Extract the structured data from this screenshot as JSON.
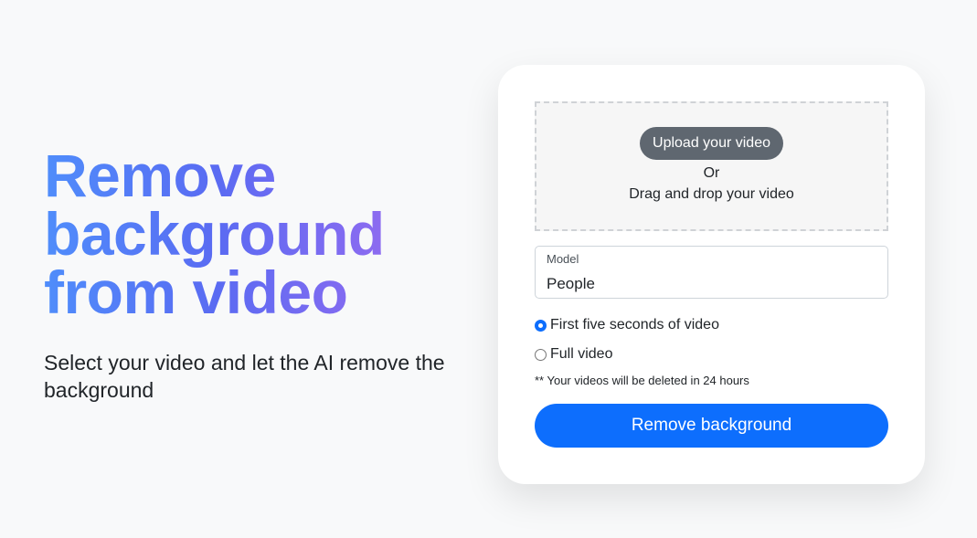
{
  "hero": {
    "title": "Remove background from video",
    "subtitle": "Select your video and let the AI remove the background"
  },
  "upload": {
    "button_label": "Upload your video",
    "or_text": "Or",
    "drag_text": "Drag and drop your video"
  },
  "model": {
    "label": "Model",
    "value": "People"
  },
  "options": [
    {
      "label": "First five seconds of video",
      "selected": true
    },
    {
      "label": "Full video",
      "selected": false
    }
  ],
  "note": "** Your videos will be deleted in 24 hours",
  "submit_label": "Remove background",
  "colors": {
    "accent": "#0d6efd",
    "upload_button": "#5f6770",
    "title_gradient_start": "#4f8dfb",
    "title_gradient_end": "#9a6bf0"
  }
}
